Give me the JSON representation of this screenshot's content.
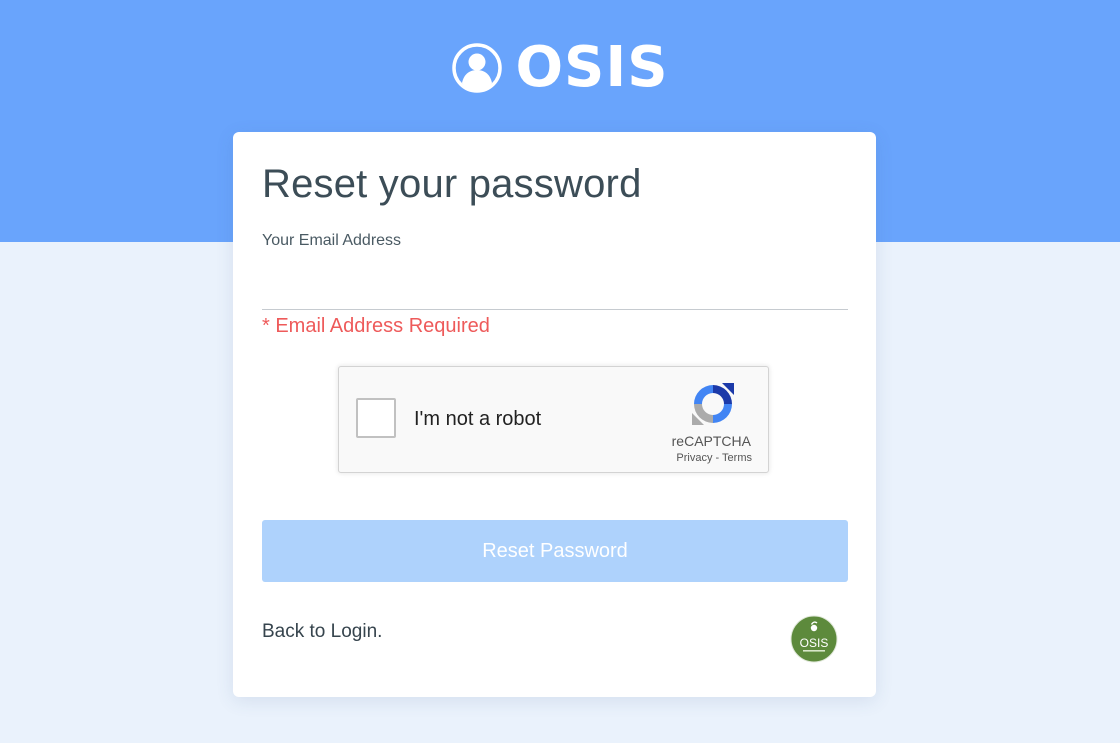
{
  "brand": {
    "name": "OSIS",
    "icon": "user-circle-icon"
  },
  "form": {
    "title": "Reset your password",
    "email_label": "Your Email Address",
    "email_value": "",
    "error": "* Email Address Required",
    "submit_label": "Reset Password",
    "back_link": "Back to Login."
  },
  "captcha": {
    "label": "I'm not a robot",
    "brand": "reCAPTCHA",
    "privacy": "Privacy",
    "separator": "-",
    "terms": "Terms",
    "checked": false
  },
  "badge": {
    "text": "OSIS",
    "icon": "osis-badge-icon"
  },
  "colors": {
    "header": "#69a4fc",
    "background": "#eaf2fc",
    "error": "#ee5a5a",
    "button": "#aed2fc",
    "badge": "#5d8a3c"
  }
}
